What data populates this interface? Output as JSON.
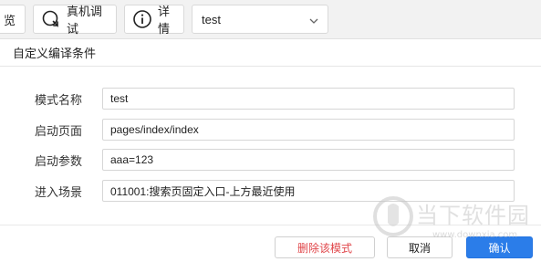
{
  "toolbar": {
    "preview_label": "预览",
    "real_debug_label": "真机调试",
    "details_label": "详情",
    "mode_select_value": "test"
  },
  "dialog": {
    "title": "自定义编译条件",
    "fields": [
      {
        "label": "模式名称",
        "value": "test"
      },
      {
        "label": "启动页面",
        "value": "pages/index/index"
      },
      {
        "label": "启动参数",
        "value": "aaa=123"
      },
      {
        "label": "进入场景",
        "value": "011001:搜索页固定入口-上方最近使用"
      }
    ],
    "buttons": {
      "delete": "删除该模式",
      "cancel": "取消",
      "confirm": "确认"
    }
  },
  "watermark": {
    "text": "当下软件园",
    "url": "www.downxia.com"
  },
  "colors": {
    "primary": "#2b7de9",
    "danger": "#e0464a"
  }
}
